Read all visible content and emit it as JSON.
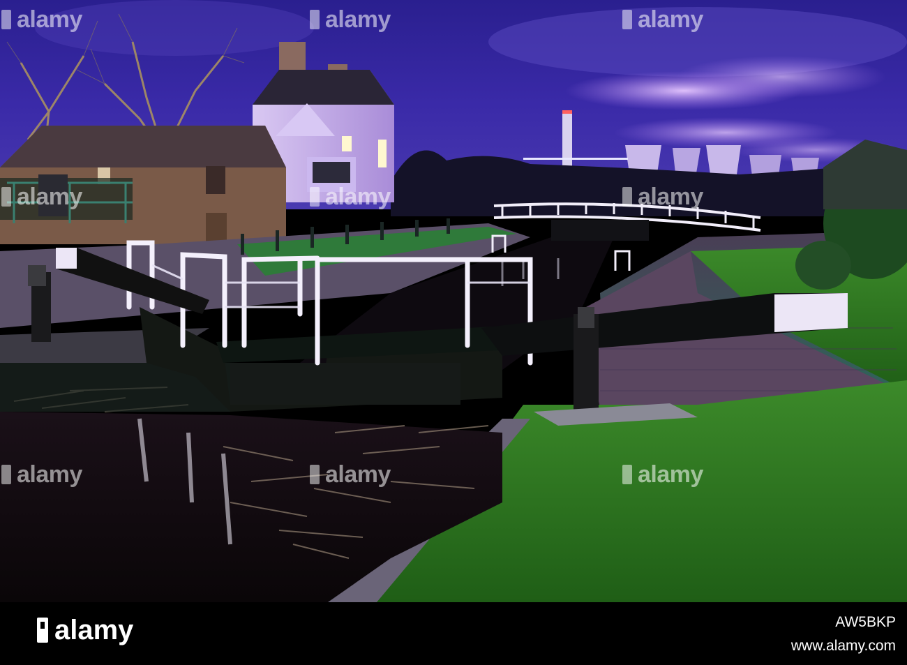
{
  "watermark": {
    "brand": "alamy"
  },
  "footer": {
    "brand": "alamy",
    "site": "www.alamy.com",
    "image_code": "AW5BKP"
  }
}
